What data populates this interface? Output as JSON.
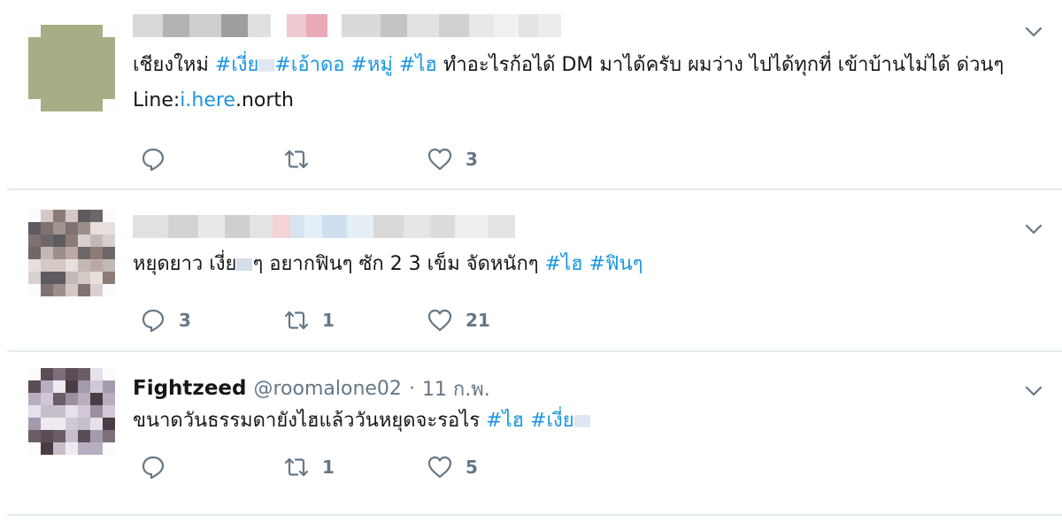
{
  "colors": {
    "link": "#1b95e0",
    "muted": "#657786",
    "divider": "#e6ecf0",
    "text": "#14171a"
  },
  "tweets": [
    {
      "display_name": "",
      "handle": "",
      "date": "",
      "text": {
        "t1": "เชียงใหม่ ",
        "tag1": "#เงี่ย",
        "tag2": "#เอ้าดอ",
        "s1": " ",
        "tag3": "#หมู่",
        "s2": "  ",
        "tag4": "#ไฮ",
        "t2": "  ทำอะไรก้อได้ DM  มาได้ครับ ผมว่าง ไปได้ทุกที่ เข้าบ้านไม่ได้ ด่วนๆ Line:",
        "link": "i.here",
        "t3": ".north"
      },
      "actions": {
        "reply": "",
        "retweet": "",
        "like": "3"
      },
      "icons": [
        "reply-icon",
        "retweet-icon",
        "heart-icon",
        "chevron-down-icon"
      ]
    },
    {
      "display_name": "",
      "handle": "",
      "date": "",
      "text": {
        "t1": "หยุดยาว เงี่ย",
        "t2": "ๆ อยากฟินๆ ซัก 2 3 เข็ม จัดหนักๆ ",
        "tag1": "#ไฮ",
        "s1": " ",
        "tag2": "#ฟินๆ"
      },
      "actions": {
        "reply": "3",
        "retweet": "1",
        "like": "21"
      },
      "icons": [
        "reply-icon",
        "retweet-icon",
        "heart-icon",
        "chevron-down-icon"
      ]
    },
    {
      "display_name": "Fightzeed",
      "handle": "@roomalone02",
      "dot": "·",
      "date": "11 ก.พ.",
      "text": {
        "t1": "ขนาดวันธรรมดายังไฮแล้ววันหยุดจะรอไร ",
        "tag1": "#ไฮ",
        "s1": " ",
        "tag2": "#เงี่ย"
      },
      "actions": {
        "reply": "",
        "retweet": "1",
        "like": "5"
      },
      "icons": [
        "reply-icon",
        "retweet-icon",
        "heart-icon",
        "chevron-down-icon"
      ]
    }
  ]
}
